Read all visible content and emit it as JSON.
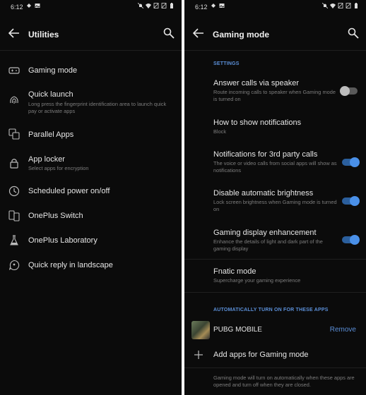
{
  "left": {
    "status_time": "6:12",
    "title": "Utilities",
    "items": [
      {
        "label": "Gaming mode",
        "sub": ""
      },
      {
        "label": "Quick launch",
        "sub": "Long press the fingerprint identification area to launch quick pay or activate apps"
      },
      {
        "label": "Parallel Apps",
        "sub": ""
      },
      {
        "label": "App locker",
        "sub": "Select apps for encryption"
      },
      {
        "label": "Scheduled power on/off",
        "sub": ""
      },
      {
        "label": "OnePlus Switch",
        "sub": ""
      },
      {
        "label": "OnePlus Laboratory",
        "sub": ""
      },
      {
        "label": "Quick reply in landscape",
        "sub": ""
      }
    ]
  },
  "right": {
    "status_time": "6:12",
    "title": "Gaming mode",
    "settings_header": "SETTINGS",
    "settings": [
      {
        "label": "Answer calls via speaker",
        "sub": "Route incoming calls to speaker when Gaming mode is turned on",
        "toggle": false
      },
      {
        "label": "How to show notifications",
        "sub": "Block"
      },
      {
        "label": "Notifications for 3rd party calls",
        "sub": "The voice or video calls from social apps will show as notifications",
        "toggle": true
      },
      {
        "label": "Disable automatic brightness",
        "sub": "Lock screen brightness when Gaming mode is turned on",
        "toggle": true
      },
      {
        "label": "Gaming display enhancement",
        "sub": "Enhance the details of light and dark part of the gaming display",
        "toggle": true
      },
      {
        "label": "Fnatic mode",
        "sub": "Supercharge your gaming experience"
      }
    ],
    "apps_header": "AUTOMATICALLY TURN ON FOR THESE APPS",
    "app_name": "PUBG MOBILE",
    "remove_label": "Remove",
    "add_label": "Add apps for Gaming mode",
    "footer": "Gaming mode will turn on automatically when these apps are opened and turn off when they are closed."
  },
  "colors": {
    "accent": "#5b8fd8",
    "background": "#0b0b0b",
    "toggle_on": "#4a90e8"
  },
  "icons": [
    "back-arrow-icon",
    "search-icon",
    "gamepad-icon",
    "fingerprint-icon",
    "parallel-apps-icon",
    "lock-icon",
    "clock-icon",
    "switch-phones-icon",
    "lab-flask-icon",
    "quick-reply-icon",
    "plus-icon"
  ]
}
